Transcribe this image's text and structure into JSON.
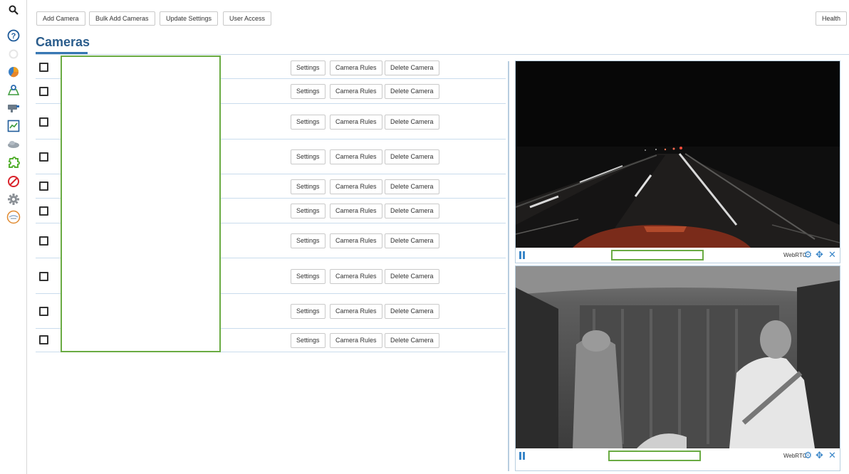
{
  "sidebar": {
    "items": [
      {
        "icon": "search-icon"
      },
      {
        "icon": "help-icon"
      },
      {
        "icon": "loading-spinner-icon"
      },
      {
        "icon": "pie-chart-icon"
      },
      {
        "icon": "map-pin-icon"
      },
      {
        "icon": "camera-icon"
      },
      {
        "icon": "trend-chart-icon"
      },
      {
        "icon": "cloud-icon"
      },
      {
        "icon": "puzzle-icon"
      },
      {
        "icon": "blocked-icon"
      },
      {
        "icon": "gear-icon"
      },
      {
        "icon": "logo-badge-icon"
      }
    ]
  },
  "toolbar": {
    "add_camera": "Add Camera",
    "bulk_add": "Bulk Add Cameras",
    "update_settings": "Update Settings",
    "user_access": "User Access",
    "health": "Health"
  },
  "page": {
    "title": "Cameras"
  },
  "camera_rows": {
    "settings_label": "Settings",
    "rules_label": "Camera Rules",
    "delete_label": "Delete Camera",
    "count": 10
  },
  "players": [
    {
      "stream_label": "WebRTC"
    },
    {
      "stream_label": "WebRTC"
    }
  ],
  "colors": {
    "accent": "#2b5d8c",
    "icon_blue": "#3a86c8",
    "redaction": "#6aab43"
  }
}
